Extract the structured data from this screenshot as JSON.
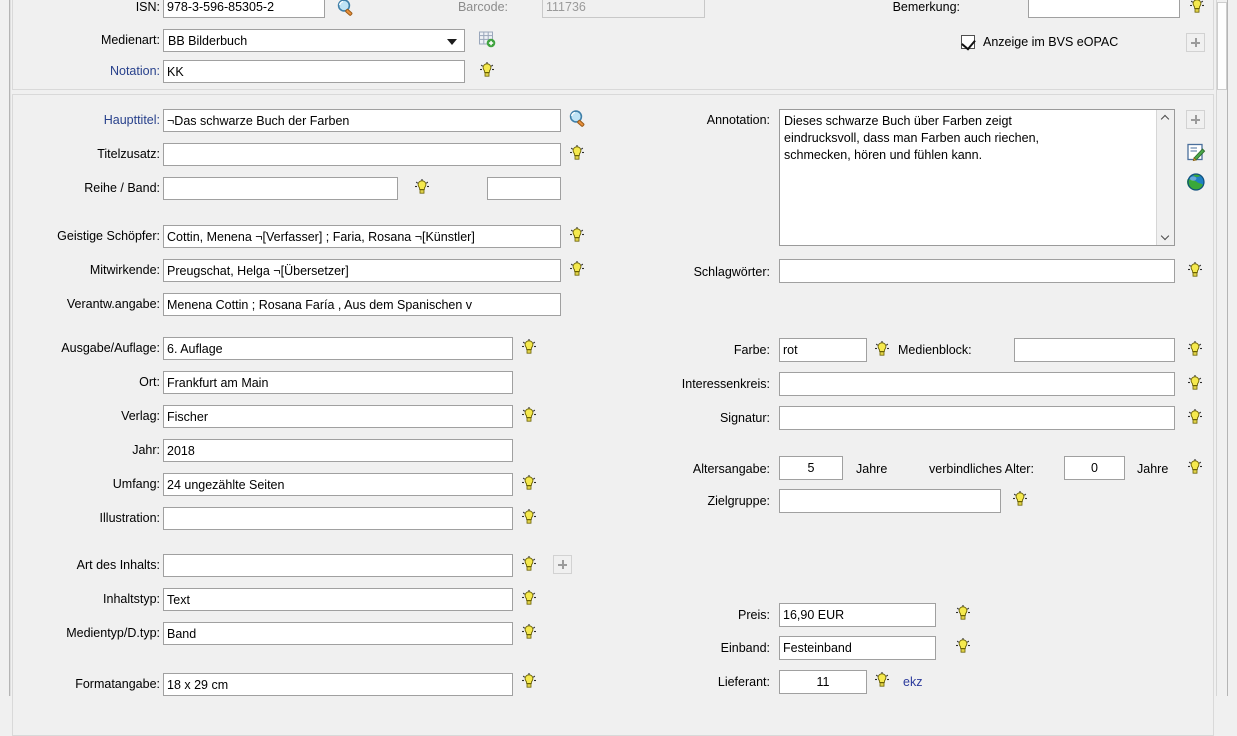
{
  "window": {
    "scrollbar": "vertical-scrollbar"
  },
  "top_section": {
    "isbn": {
      "label": "ISN:",
      "value": "978-3-596-85305-2",
      "search_icon": "magnifier-icon"
    },
    "barcode": {
      "label": "Barcode:",
      "value": "111736"
    },
    "bemerkung": {
      "label": "Bemerkung:",
      "value": ""
    },
    "medienart": {
      "label": "Medienart:",
      "value": "BB   Bilderbuch",
      "add_icon": "grid-add-icon"
    },
    "notation": {
      "label": "Notation:",
      "value": "KK"
    },
    "eopac": {
      "label": "Anzeige im BVS eOPAC",
      "checked": true
    }
  },
  "left_column": {
    "haupttitel": {
      "label": "Haupttitel:",
      "value": "¬Das schwarze Buch der Farben"
    },
    "titelzusatz": {
      "label": "Titelzusatz:",
      "value": ""
    },
    "reihe_band": {
      "label": "Reihe / Band:",
      "value": "",
      "band_value": ""
    },
    "geistige_schoepfer": {
      "label": "Geistige Schöpfer:",
      "value": "Cottin, Menena ¬[Verfasser] ; Faria, Rosana ¬[Künstler]"
    },
    "mitwirkende": {
      "label": "Mitwirkende:",
      "value": "Preugschat, Helga ¬[Übersetzer]"
    },
    "verantw_angabe": {
      "label": "Verantw.angabe:",
      "value": "Menena Cottin ; Rosana Faría , Aus dem Spanischen v"
    },
    "ausgabe": {
      "label": "Ausgabe/Auflage:",
      "value": "6. Auflage"
    },
    "ort": {
      "label": "Ort:",
      "value": "Frankfurt am Main"
    },
    "verlag": {
      "label": "Verlag:",
      "value": "Fischer"
    },
    "jahr": {
      "label": "Jahr:",
      "value": "2018"
    },
    "umfang": {
      "label": "Umfang:",
      "value": "24 ungezählte Seiten"
    },
    "illustration": {
      "label": "Illustration:",
      "value": ""
    },
    "art_des_inhalts": {
      "label": "Art des Inhalts:",
      "value": ""
    },
    "inhaltstyp": {
      "label": "Inhaltstyp:",
      "value": "Text"
    },
    "medientyp": {
      "label": "Medientyp/D.typ:",
      "value": "Band"
    },
    "formatangabe": {
      "label": "Formatangabe:",
      "value": "18 x 29 cm"
    }
  },
  "right_column": {
    "annotation": {
      "label": "Annotation:",
      "value": "Dieses schwarze Buch über Farben zeigt\neindrucksvoll, dass man Farben auch riechen,\nschmecken, hören und fühlen kann."
    },
    "annotation_tools": {
      "add": "plus-button",
      "edit": "edit-note-icon",
      "web": "globe-icon"
    },
    "schlagwoerter": {
      "label": "Schlagwörter:",
      "value": ""
    },
    "farbe": {
      "label": "Farbe:",
      "value": "rot"
    },
    "medienblock": {
      "label": "Medienblock:",
      "value": ""
    },
    "interessenkreis": {
      "label": "Interessenkreis:",
      "value": ""
    },
    "signatur": {
      "label": "Signatur:",
      "value": ""
    },
    "altersangabe": {
      "label": "Altersangabe:",
      "value": "5",
      "unit": "Jahre"
    },
    "verbindliches_alter": {
      "label": "verbindliches Alter:",
      "value": "0",
      "unit": "Jahre"
    },
    "zielgruppe": {
      "label": "Zielgruppe:",
      "value": ""
    },
    "preis": {
      "label": "Preis:",
      "value": "16,90 EUR"
    },
    "einband": {
      "label": "Einband:",
      "value": "Festeinband"
    },
    "lieferant": {
      "label": "Lieferant:",
      "value": "11",
      "name": "ekz"
    }
  },
  "icons": {
    "bulb": "lightbulb-hint-icon",
    "magnifier": "magnifier-icon",
    "plus": "plus-button"
  },
  "colors": {
    "label_blue": "#28418c",
    "bulb_yellow": "#f2e24a",
    "face": "#f0f0f0",
    "field_border": "#a0a0a0"
  }
}
